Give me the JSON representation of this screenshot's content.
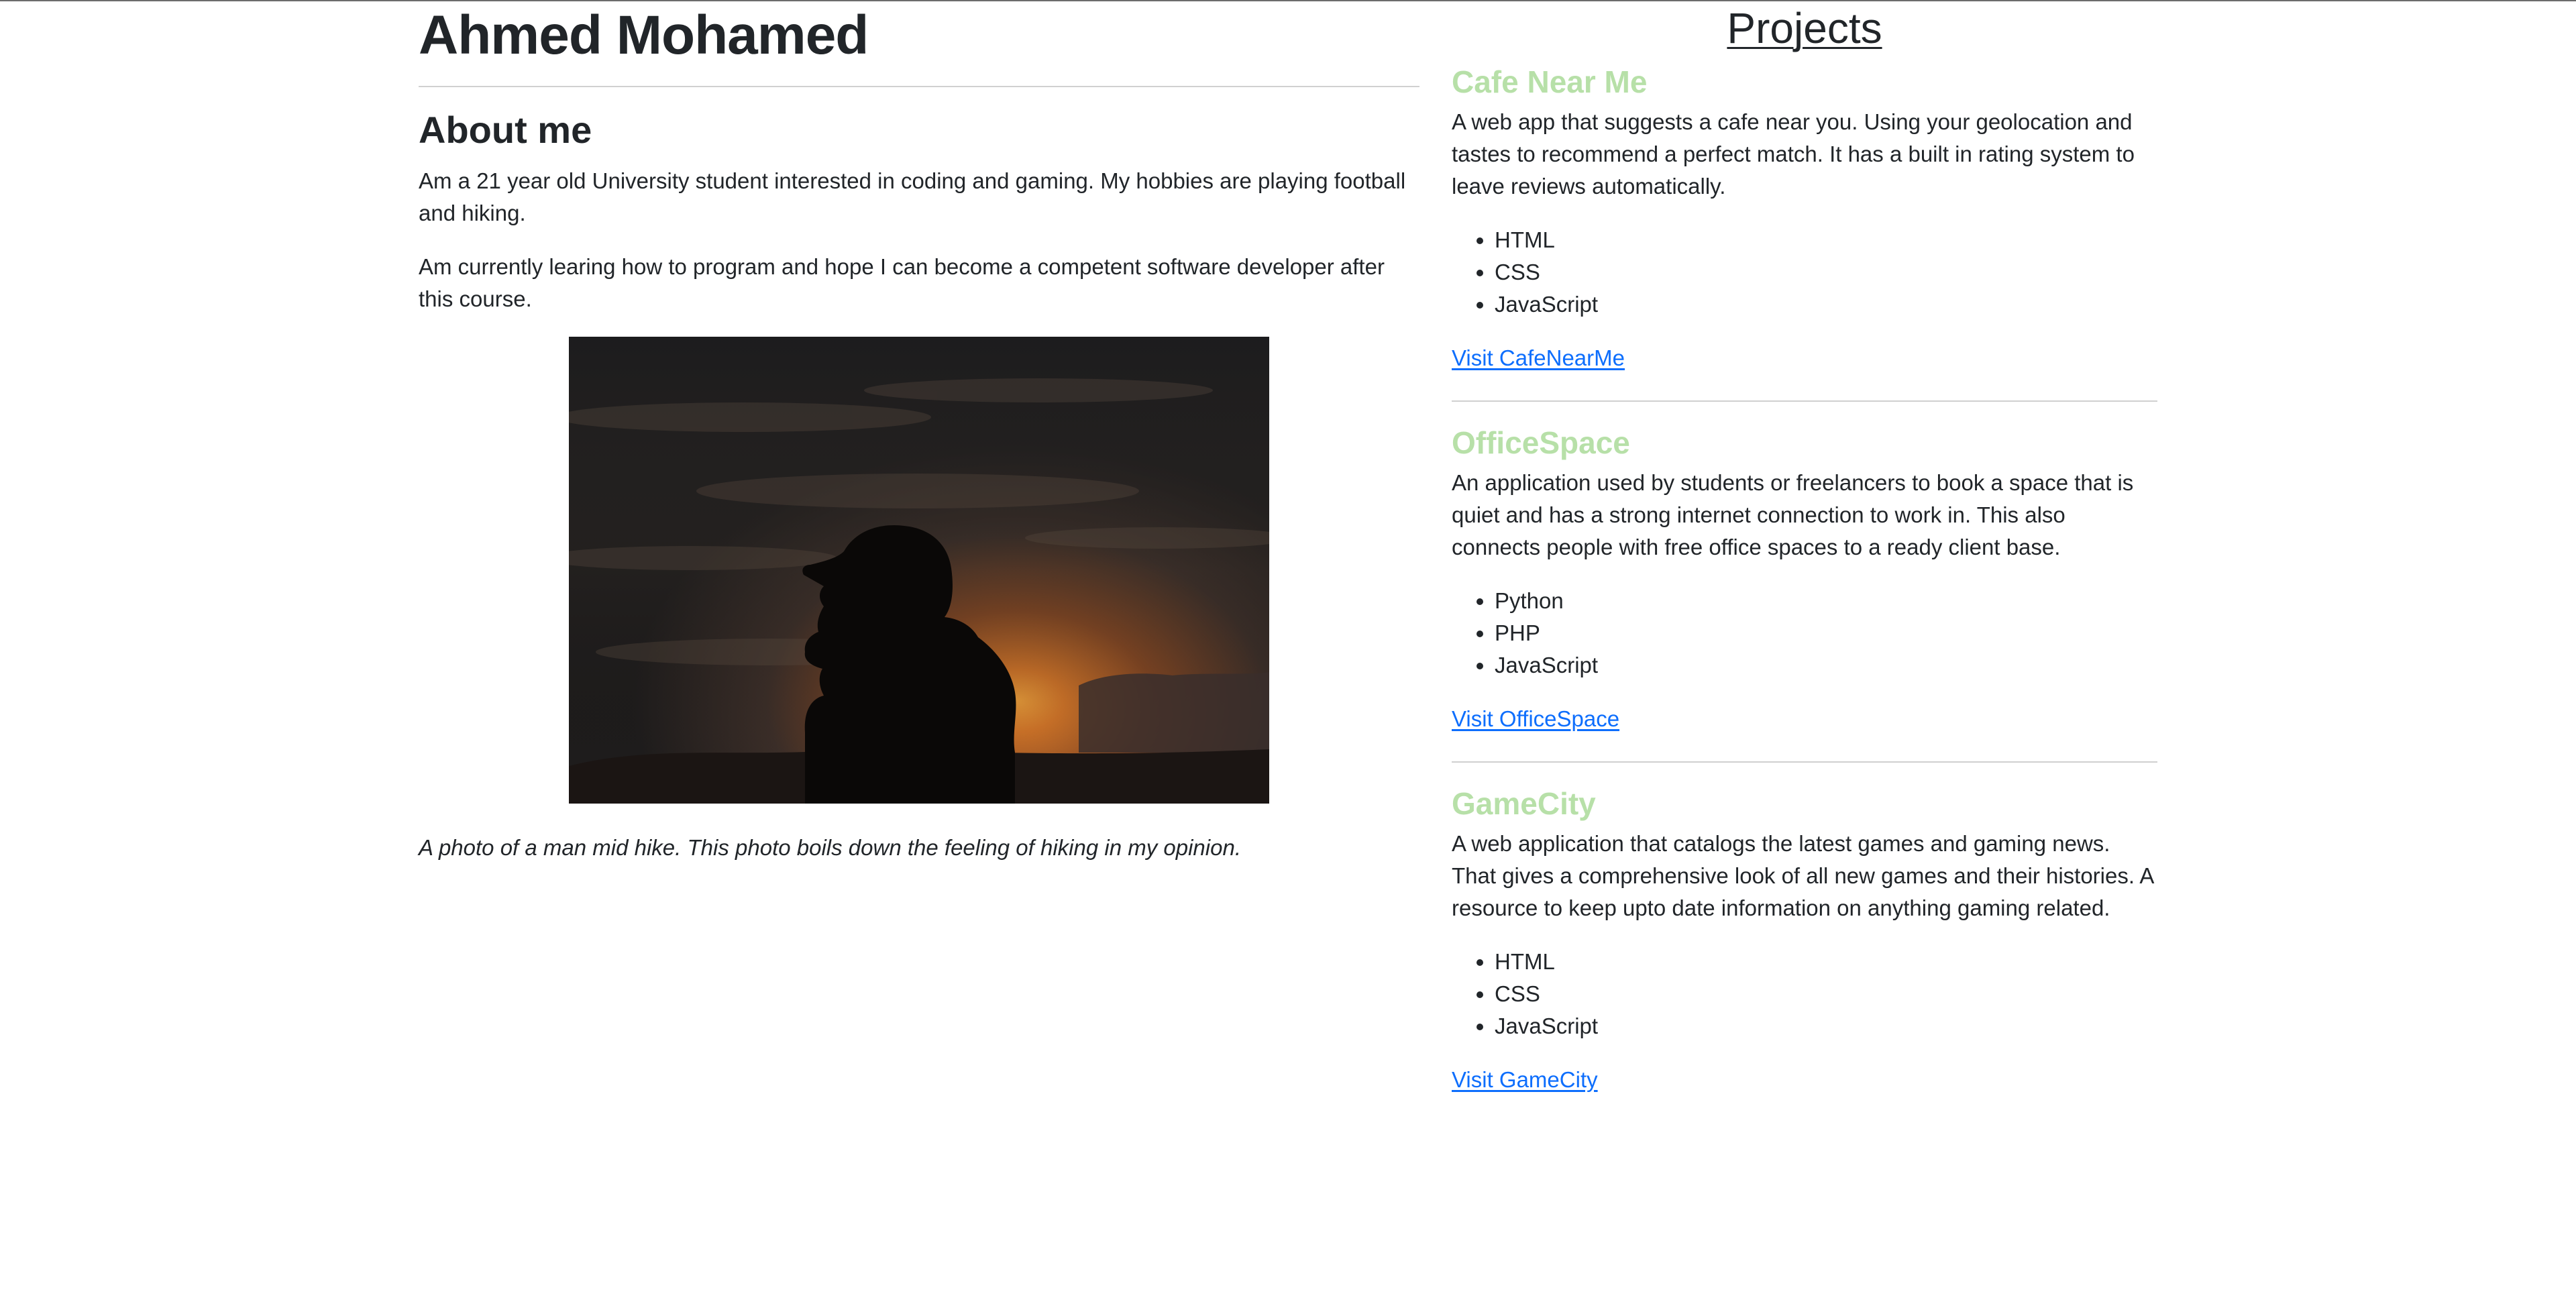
{
  "profile": {
    "name": "Ahmed Mohamed"
  },
  "about": {
    "title": "About me",
    "paragraphs": [
      "Am a 21 year old University student interested in coding and gaming. My hobbies are playing football and hiking.",
      "Am currently learing how to program and hope I can become a competent software developer after this course."
    ],
    "photo_icon": "hiker-silhouette-sunset-photo",
    "caption": "A photo of a man mid hike. This photo boils down the feeling of hiking in my opinion."
  },
  "projects": {
    "title": "Projects",
    "title_color": "#b7e0a8",
    "link_color": "#0d6efd",
    "items": [
      {
        "title": "Cafe Near Me",
        "description": "A web app that suggests a cafe near you. Using your geolocation and tastes to recommend a perfect match. It has a built in rating system to leave reviews automatically.",
        "tech": [
          "HTML",
          "CSS",
          "JavaScript"
        ],
        "link": "Visit CafeNearMe"
      },
      {
        "title": "OfficeSpace",
        "description": "An application used by students or freelancers to book a space that is quiet and has a strong internet connection to work in. This also connects people with free office spaces to a ready client base.",
        "tech": [
          "Python",
          "PHP",
          "JavaScript"
        ],
        "link": "Visit OfficeSpace"
      },
      {
        "title": "GameCity",
        "description": "A web application that catalogs the latest games and gaming news. That gives a comprehensive look of all new games and their histories. A resource to keep upto date information on anything gaming related.",
        "tech": [
          "HTML",
          "CSS",
          "JavaScript"
        ],
        "link": "Visit GameCity"
      }
    ]
  }
}
